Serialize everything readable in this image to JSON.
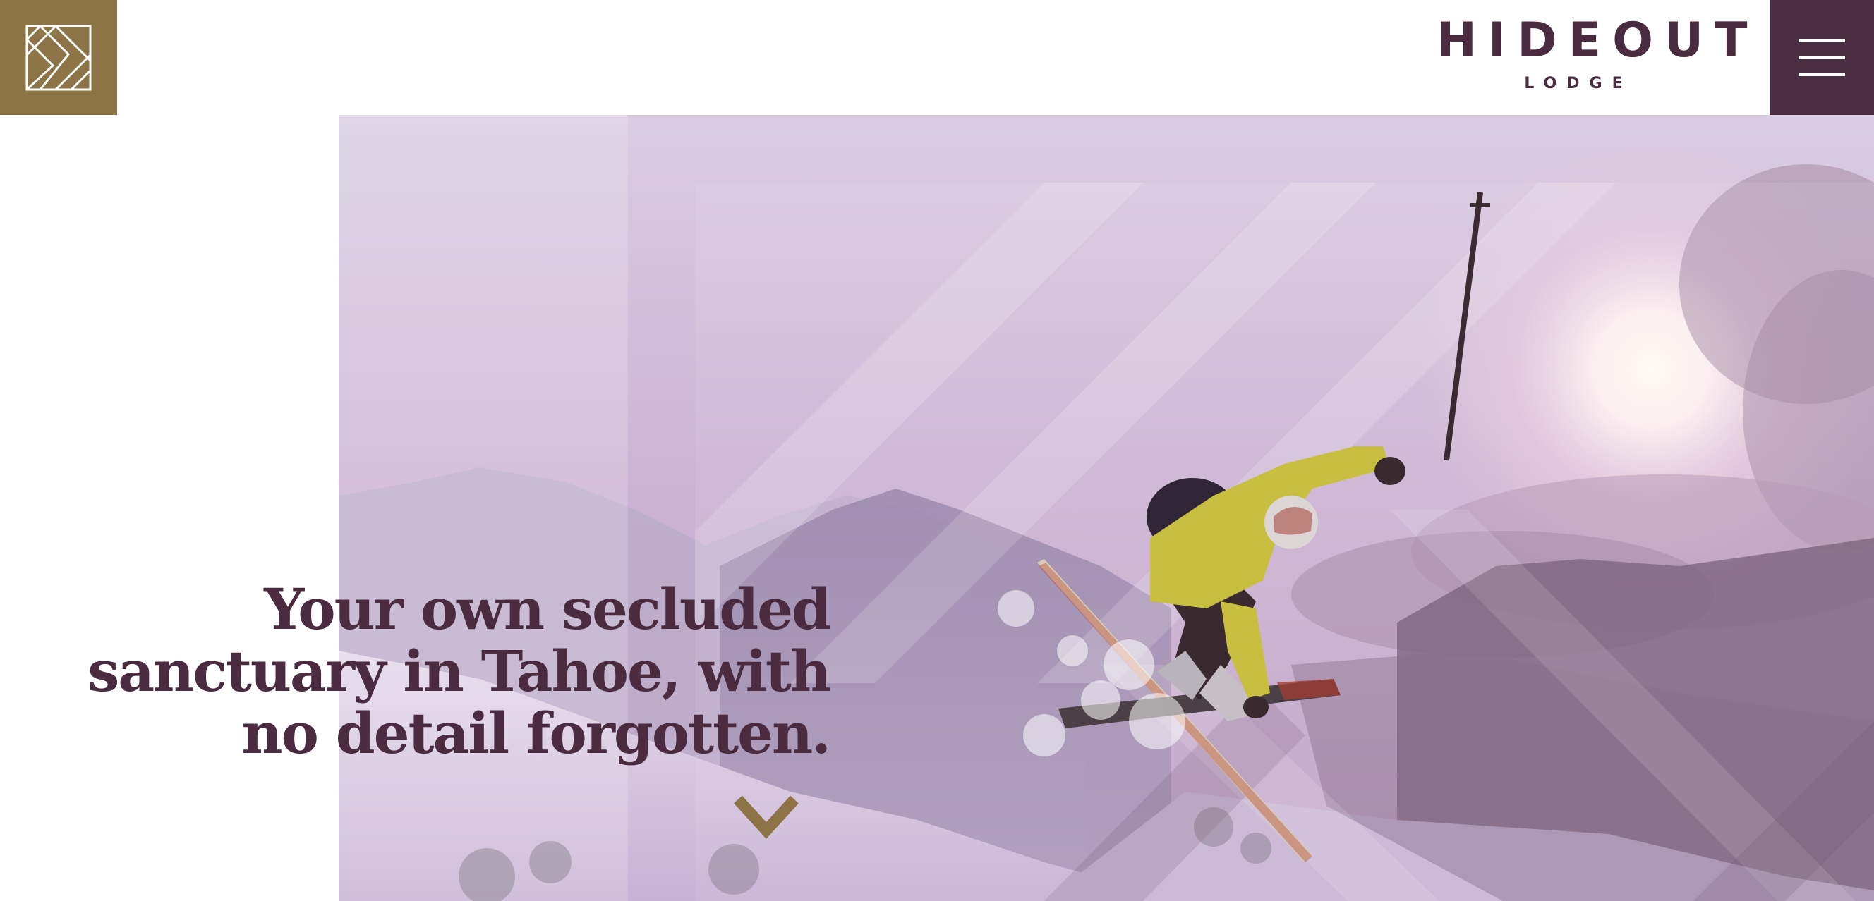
{
  "header": {
    "brand_name": "HIDEOUT",
    "brand_sub": "LODGE",
    "logo_icon": "lodge-monogram-icon",
    "menu_icon": "hamburger-menu-icon"
  },
  "hero": {
    "tagline_line1": "Your own secluded",
    "tagline_line2": "sanctuary in Tahoe, with",
    "tagline_line3": "no detail forgotten.",
    "scroll_icon": "chevron-down-icon",
    "image_subject": "skier-jumping-mountain-photo"
  },
  "colors": {
    "brand_plum": "#4a2b3f",
    "brand_gold": "#8c7447",
    "menu_bg": "#4a2d40",
    "overlay_lavender": "#b9a3cb"
  }
}
